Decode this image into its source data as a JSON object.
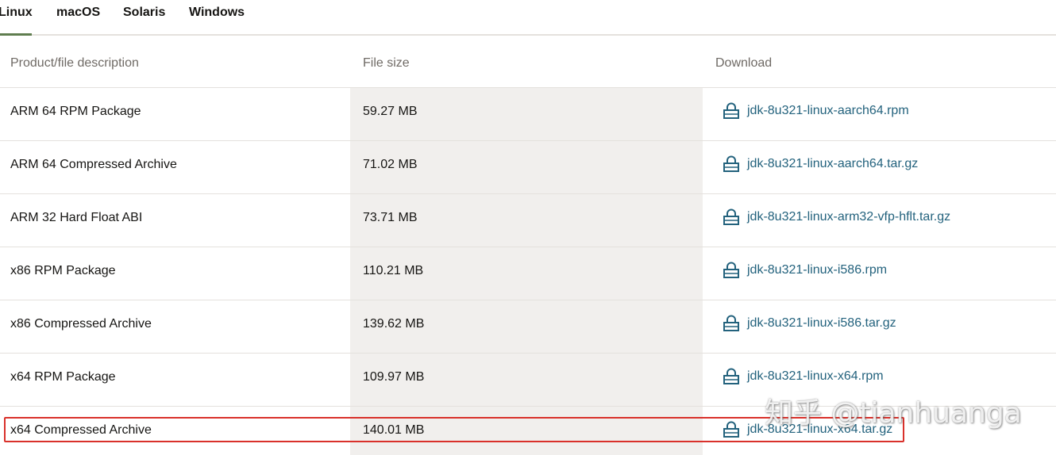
{
  "tabs": [
    {
      "label": "Linux",
      "active": true
    },
    {
      "label": "macOS",
      "active": false
    },
    {
      "label": "Solaris",
      "active": false
    },
    {
      "label": "Windows",
      "active": false
    }
  ],
  "table": {
    "headers": [
      "Product/file description",
      "File size",
      "Download"
    ],
    "rows": [
      {
        "description": "ARM 64 RPM Package",
        "size": "59.27 MB",
        "file": "jdk-8u321-linux-aarch64.rpm"
      },
      {
        "description": "ARM 64 Compressed Archive",
        "size": "71.02 MB",
        "file": "jdk-8u321-linux-aarch64.tar.gz"
      },
      {
        "description": "ARM 32 Hard Float ABI",
        "size": "73.71 MB",
        "file": "jdk-8u321-linux-arm32-vfp-hflt.tar.gz"
      },
      {
        "description": "x86 RPM Package",
        "size": "110.21 MB",
        "file": "jdk-8u321-linux-i586.rpm"
      },
      {
        "description": "x86 Compressed Archive",
        "size": "139.62 MB",
        "file": "jdk-8u321-linux-i586.tar.gz"
      },
      {
        "description": "x64 RPM Package",
        "size": "109.97 MB",
        "file": "jdk-8u321-linux-x64.rpm"
      },
      {
        "description": "x64 Compressed Archive",
        "size": "140.01 MB",
        "file": "jdk-8u321-linux-x64.tar.gz"
      }
    ]
  },
  "icons": {
    "download": "lock-icon"
  },
  "colors": {
    "accent": "#5f7d4f",
    "link": "#23627d",
    "highlight": "#d9312b",
    "shaded": "#f1efed"
  },
  "watermark": "知乎 @tianhuanga"
}
